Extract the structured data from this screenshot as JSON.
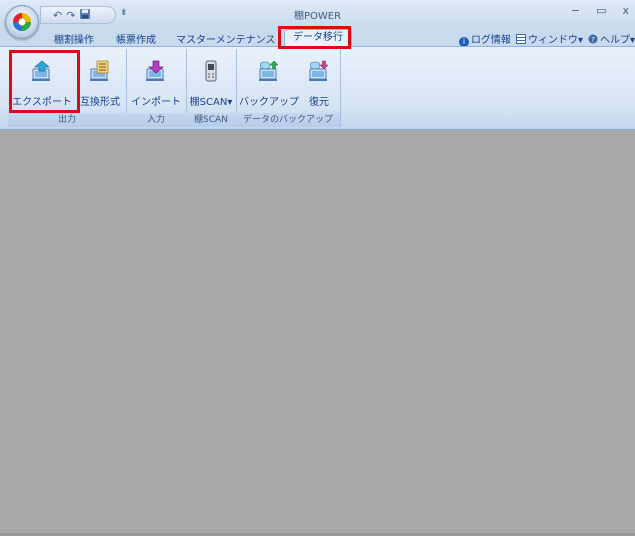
{
  "window": {
    "title": "棚POWER",
    "minimize_glyph": "−",
    "maximize_glyph": "▭",
    "close_glyph": "x"
  },
  "quick_access": {
    "undo_glyph": "↶",
    "redo_glyph": "↷",
    "save_glyph": "▪",
    "more_glyph": "⇟"
  },
  "tabs": [
    {
      "label": "棚割操作"
    },
    {
      "label": "帳票作成"
    },
    {
      "label": "マスターメンテナンス"
    },
    {
      "label": "データ移行"
    }
  ],
  "right_menu": {
    "log_info": "ログ情報",
    "window": "ウィンドウ",
    "help": "ヘルプ",
    "dropdown_glyph": "▾"
  },
  "ribbon": {
    "groups": [
      {
        "label": "出力",
        "buttons": [
          {
            "label": "エクスポート",
            "icon": "export-icon"
          },
          {
            "label": "互換形式",
            "icon": "compat-format-icon"
          }
        ]
      },
      {
        "label": "入力",
        "buttons": [
          {
            "label": "インポート",
            "icon": "import-icon"
          }
        ]
      },
      {
        "label": "棚SCAN",
        "buttons": [
          {
            "label": "棚SCAN",
            "icon": "handheld-scanner-icon"
          }
        ]
      },
      {
        "label": "データのバックアップ",
        "buttons": [
          {
            "label": "バックアップ",
            "icon": "backup-icon"
          },
          {
            "label": "復元",
            "icon": "restore-icon"
          }
        ]
      }
    ]
  },
  "colors": {
    "highlight": "#e30613",
    "workspace": "#a8a8a8",
    "ribbon_text": "#15428b"
  }
}
